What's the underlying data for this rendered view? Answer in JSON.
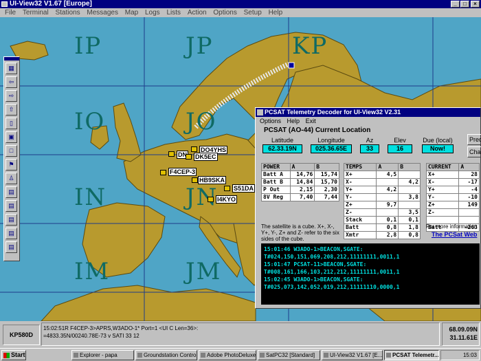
{
  "window": {
    "title": "UI-View32 V1.67 [Europe]"
  },
  "menu": [
    "File",
    "Terminal",
    "Stations",
    "Messages",
    "Map",
    "Logs",
    "Lists",
    "Action",
    "Options",
    "Setup",
    "Help"
  ],
  "map": {
    "grid_labels": [
      "IP",
      "JP",
      "KP",
      "IO",
      "JO",
      "IN",
      "JN",
      "IM",
      "JM"
    ],
    "stations": [
      "DO4YHS",
      "DN",
      "DK5EC",
      "F4CEP-3",
      "HB9SKA",
      "S51DA",
      "I4KYO"
    ],
    "colors": {
      "sea": "#4fa5c6",
      "land": "#b89a2e",
      "grid": "#1e3c8a",
      "track": "#e8e8e8"
    }
  },
  "pcsat": {
    "title": "PCSAT Telemetry Decoder for UI-View32   V2.31",
    "menu": [
      "Options",
      "Help",
      "Exit"
    ],
    "location_heading": "PCSAT (AO-44) Current Location",
    "fields": [
      {
        "label": "Latitude",
        "value": "62.33.19N"
      },
      {
        "label": "Longitude",
        "value": "025.36.65E"
      },
      {
        "label": "Az",
        "value": "33"
      },
      {
        "label": "Elev",
        "value": "16"
      },
      {
        "label": "Due (local)",
        "value": "Now!"
      }
    ],
    "side_buttons": [
      "Pred",
      "Chan"
    ],
    "power": {
      "headers": [
        "POWER",
        "A",
        "B"
      ],
      "rows": [
        [
          "Batt A",
          "14,76",
          "15,74"
        ],
        [
          "Batt B",
          "14,84",
          "15,70"
        ],
        [
          "P Out",
          "2,15",
          "2,30"
        ],
        [
          "8V Reg",
          "7,40",
          "7,44"
        ]
      ]
    },
    "temps": {
      "headers": [
        "TEMPS",
        "A",
        "B"
      ],
      "rows": [
        [
          "X+",
          "4,5",
          ""
        ],
        [
          "X-",
          "",
          "4,2"
        ],
        [
          "Y+",
          "4,2",
          ""
        ],
        [
          "Y-",
          "",
          "3,8"
        ],
        [
          "Z+",
          "9,7",
          ""
        ],
        [
          "Z-",
          "",
          "3,5"
        ],
        [
          "Stack",
          "0,1",
          "0,1"
        ],
        [
          "Batt",
          "0,8",
          "1,8"
        ],
        [
          "Xmtr",
          "2,8",
          "0,8"
        ]
      ]
    },
    "current": {
      "headers": [
        "CURRENT",
        "A"
      ],
      "rows": [
        [
          "X+",
          "28"
        ],
        [
          "X-",
          "-17"
        ],
        [
          "Y+",
          "-4"
        ],
        [
          "Y-",
          "-10"
        ],
        [
          "Z+",
          "149"
        ],
        [
          "Z-",
          ""
        ],
        [
          "",
          ""
        ],
        [
          "Batt",
          "-263"
        ]
      ]
    },
    "note": "The satellite is a cube. X+, X-, Y+, Y-, Z+ and Z- refer to the six sides of the cube.",
    "more_info": "For more information",
    "web_link": "The PCSat Web",
    "beacons": [
      "15:01:46 W3ADO-1>BEACON,SGATE:",
      "T#024,150,151,069,208,212,11111111,0011,1",
      "15:01:47 PCSAT-11>BEACON,SGATE:",
      "T#008,161,166,103,212,212,11111111,0011,1",
      "15:02:45 W3ADO-1>BEACON,SGATE:",
      "T#025,073,142,052,019,212,11111110,0000,1"
    ]
  },
  "status": {
    "left": "KP580D",
    "line1": "15:02:51R F4CEP-3>APRS,W3ADO-1* Port=1 <UI C Len=36>:",
    "line2": "=4833.35N/00240.78E-73 v SATI  33 12",
    "lat": "68.09.09N",
    "lon": "31.11.61E"
  },
  "taskbar": {
    "start": "Start",
    "tasks": [
      "Explorer - papa",
      "Groundstation Control",
      "Adobe PhotoDeluxe...",
      "SatPC32 [Standard]",
      "UI-View32 V1.67 [E...",
      "PCSAT Telemetr..."
    ],
    "clock": "15:03"
  }
}
